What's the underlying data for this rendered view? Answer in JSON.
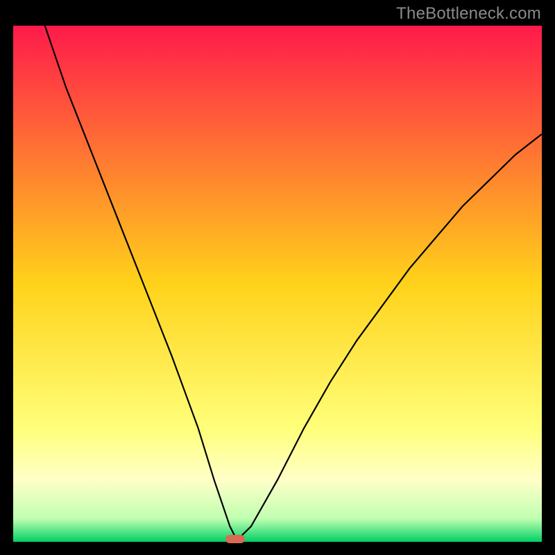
{
  "watermark": "TheBottleneck.com",
  "chart_data": {
    "type": "line",
    "title": "",
    "xlabel": "",
    "ylabel": "",
    "xlim": [
      0,
      100
    ],
    "ylim": [
      0,
      100
    ],
    "grid": false,
    "legend": false,
    "series": [
      {
        "name": "curve",
        "color": "#000000",
        "x": [
          6,
          10,
          15,
          20,
          25,
          30,
          35,
          38,
          40,
          41,
          42,
          43,
          45,
          50,
          55,
          60,
          65,
          70,
          75,
          80,
          85,
          90,
          95,
          100
        ],
        "y": [
          100,
          88,
          75,
          62,
          49,
          36,
          22,
          12,
          6,
          3,
          1,
          1,
          3,
          12,
          22,
          31,
          39,
          46,
          53,
          59,
          65,
          70,
          75,
          79
        ]
      }
    ],
    "marker": {
      "x": 42,
      "y": 0.5,
      "color": "#d86a56"
    },
    "background_gradient": {
      "stops": [
        {
          "offset": 0.0,
          "color": "#ff1a4b"
        },
        {
          "offset": 0.5,
          "color": "#ffd21a"
        },
        {
          "offset": 0.78,
          "color": "#ffff7a"
        },
        {
          "offset": 0.88,
          "color": "#ffffc8"
        },
        {
          "offset": 0.955,
          "color": "#c0ffb0"
        },
        {
          "offset": 0.985,
          "color": "#40e080"
        },
        {
          "offset": 1.0,
          "color": "#00d060"
        }
      ]
    }
  }
}
